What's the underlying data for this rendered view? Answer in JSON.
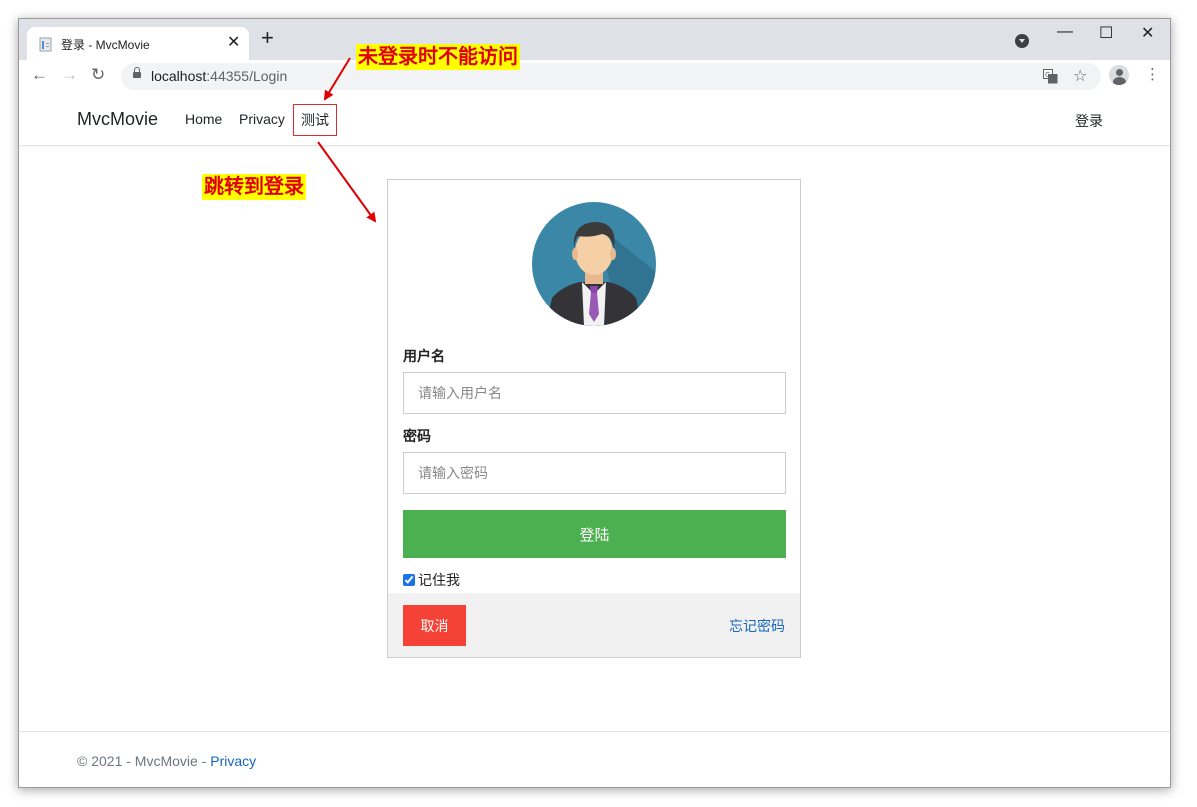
{
  "browser": {
    "tab_title": "登录 - MvcMovie",
    "tab_close": "✕",
    "new_tab": "+",
    "url_host": "localhost",
    "url_rest": ":44355/Login",
    "window_controls": {
      "minimize": "—",
      "maximize": "☐",
      "close": "✕"
    },
    "icons": [
      "back-icon",
      "forward-icon",
      "reload-icon",
      "lock-icon",
      "translate-icon",
      "star-icon",
      "profile-icon",
      "menu-icon"
    ]
  },
  "nav": {
    "brand": "MvcMovie",
    "links": [
      "Home",
      "Privacy",
      "测试"
    ],
    "login": "登录"
  },
  "login_form": {
    "username_label": "用户名",
    "username_placeholder": "请输入用户名",
    "password_label": "密码",
    "password_placeholder": "请输入密码",
    "submit_label": "登陆",
    "remember_label": "记住我",
    "remember_checked": true,
    "cancel_label": "取消",
    "forgot_label": "忘记密码"
  },
  "footer": {
    "text": "© 2021 - MvcMovie - ",
    "privacy_link": "Privacy"
  },
  "annotations": {
    "no_access_note": "未登录时不能访问",
    "redirect_note": "跳转到登录",
    "color": "#e00000",
    "highlight": "#ffff00"
  },
  "colors": {
    "login_button": "#4caf50",
    "cancel_button": "#f44336",
    "link": "#1565c0"
  }
}
